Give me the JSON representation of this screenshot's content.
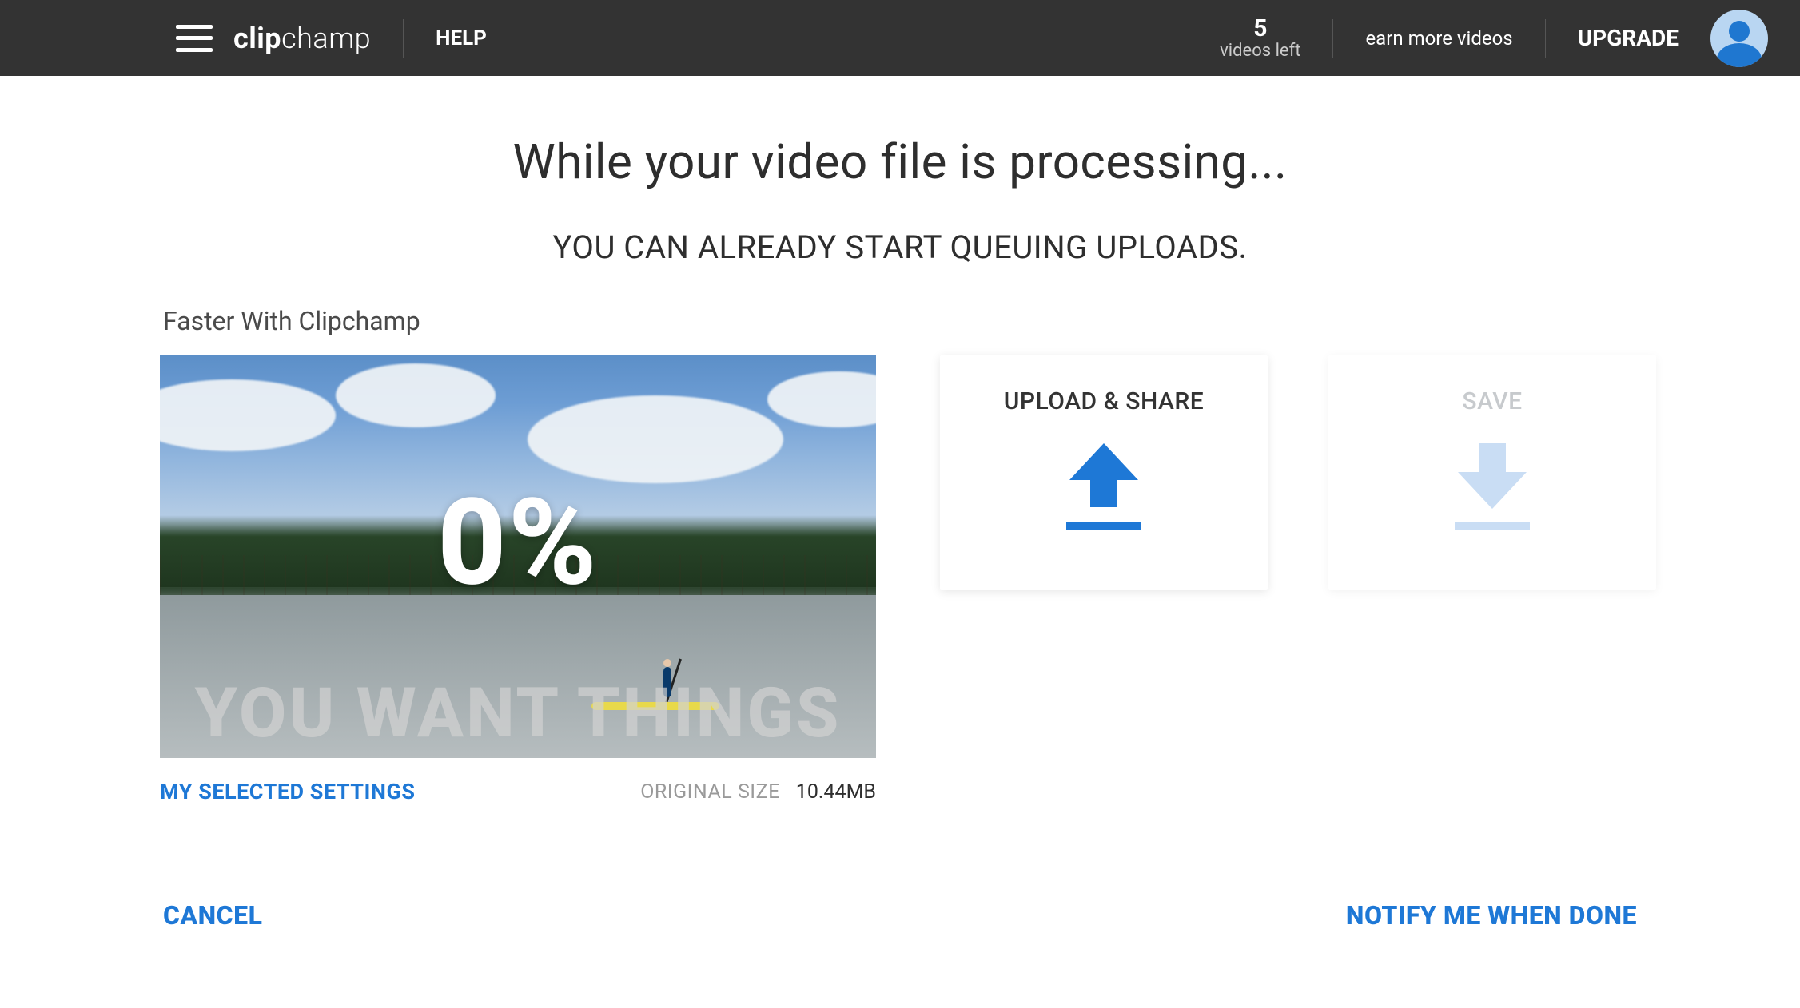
{
  "header": {
    "brand_bold": "clip",
    "brand_light": "champ",
    "help": "HELP",
    "videos_left_count": "5",
    "videos_left_label": "videos left",
    "earn": "earn more videos",
    "upgrade": "UPGRADE"
  },
  "main": {
    "title": "While your video file is processing...",
    "subtitle": "YOU CAN ALREADY START QUEUING UPLOADS.",
    "project_name": "Faster With Clipchamp",
    "progress_pct": "0%",
    "caption_overlay": "YOU WANT THINGS",
    "settings_link": "MY SELECTED SETTINGS",
    "original_size_label": "ORIGINAL SIZE",
    "original_size_value": "10.44MB"
  },
  "cards": {
    "upload_share": "UPLOAD & SHARE",
    "save": "SAVE"
  },
  "footer": {
    "cancel": "CANCEL",
    "notify": "NOTIFY ME WHEN DONE"
  },
  "colors": {
    "accent": "#1e78d6",
    "accent_light": "#9dc3ec",
    "header_bg": "#333333"
  }
}
